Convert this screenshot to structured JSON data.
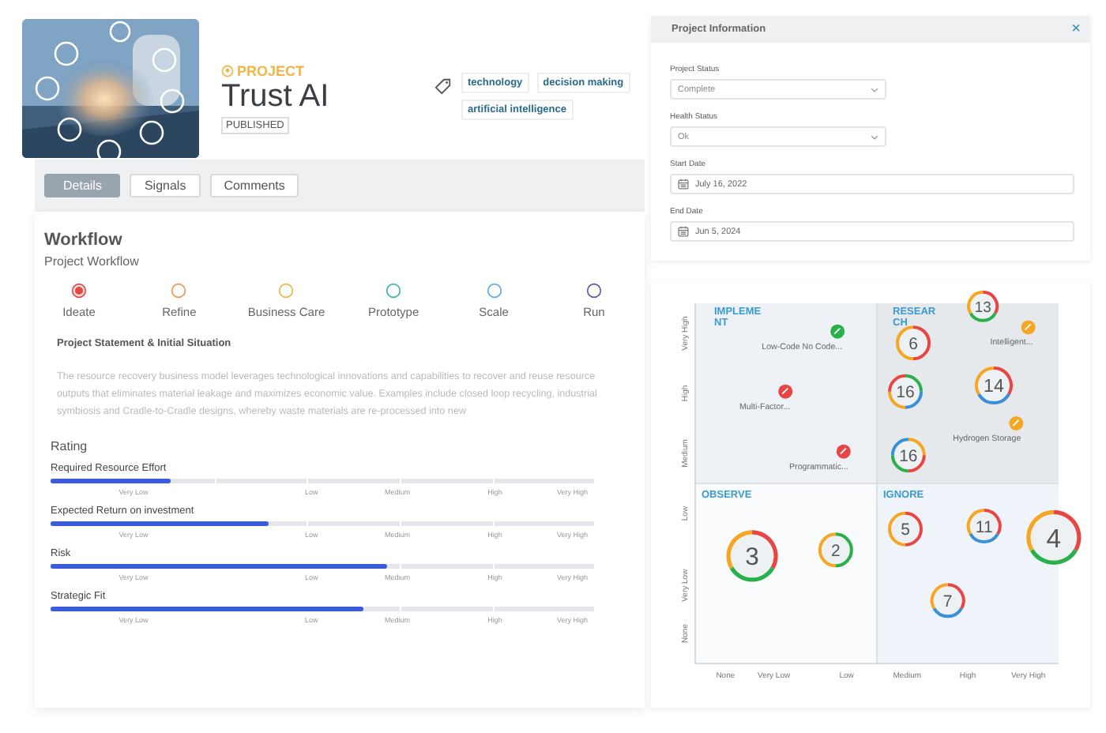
{
  "header": {
    "kind": "picture",
    "eyebrow": "PROJECT",
    "title": "Trust AI",
    "status": "PUBLISHED",
    "tags": [
      "technology",
      "decision making",
      "artificial intelligence"
    ]
  },
  "tabs": [
    {
      "label": "Details",
      "selected": true
    },
    {
      "label": "Signals",
      "selected": false
    },
    {
      "label": "Comments",
      "selected": false
    }
  ],
  "workflow": {
    "heading": "Workflow",
    "subheading": "Project Workflow",
    "steps": [
      {
        "label": "Ideate",
        "color": "#e84545",
        "selected": true
      },
      {
        "label": "Refine",
        "color": "#f0964a",
        "selected": false
      },
      {
        "label": "Business Care",
        "color": "#f2b544",
        "selected": false
      },
      {
        "label": "Prototype",
        "color": "#3bb3bd",
        "selected": false
      },
      {
        "label": "Scale",
        "color": "#5aaee0",
        "selected": false
      },
      {
        "label": "Run",
        "color": "#5a5aa8",
        "selected": false
      }
    ]
  },
  "statement": {
    "title": "Project Statement & Initial Situation",
    "text": "The resource recovery business model leverages technological innovations and capabilities to recover and reuse resource outputs that eliminates material leakage and maximizes economic value. Examples include closed loop recycling, industrial symbiosis and Cradle-to-Cradle designs, whereby waste materials are re-processed into new"
  },
  "rating": {
    "heading": "Rating",
    "rows": [
      {
        "name": "Required Resource Effort",
        "level": 0.22,
        "scale": [
          "Very Low",
          "Low",
          "Medium",
          "High",
          "Very High"
        ]
      },
      {
        "name": "Expected Return on investment",
        "level": 0.4,
        "scale": [
          "Very Low",
          "Low",
          "Medium",
          "High",
          "Very High"
        ]
      },
      {
        "name": "Risk",
        "level": 0.62,
        "scale": [
          "Very Low",
          "Low",
          "Medium",
          "High",
          "Very High"
        ]
      },
      {
        "name": "Strategic Fit",
        "level": 0.575,
        "scale": [
          "Very Low",
          "Low",
          "Medium",
          "High",
          "Very High"
        ]
      }
    ]
  },
  "info_panel": {
    "title": "Project Information",
    "close": "×",
    "fields": [
      {
        "kind": "select",
        "label": "Project Status",
        "value": "Complete"
      },
      {
        "kind": "select",
        "label": "Health Status",
        "value": "Ok"
      },
      {
        "kind": "date",
        "label": "Start Date",
        "value": "July 16, 2022"
      },
      {
        "kind": "date",
        "label": "End Date",
        "value": "Jun 5, 2024"
      }
    ]
  },
  "matrix": {
    "x_axis": [
      "None",
      "Very Low",
      "Low",
      "Medium",
      "High",
      "Very High"
    ],
    "y_axis": [
      "None",
      "Very Low",
      "Low",
      "Medium",
      "High",
      "Very High"
    ],
    "quadrants": [
      "IMPLEMENT",
      "RESEARCH",
      "OBSERVE",
      "IGNORE"
    ],
    "markers": [
      {
        "kind": "project",
        "label": "Low-Code No Code...",
        "color": "#2ab04a"
      },
      {
        "kind": "project",
        "label": "Intelligent...",
        "color": "#f5a623"
      },
      {
        "kind": "project",
        "label": "Multi-Factor...",
        "color": "#e84545"
      },
      {
        "kind": "project",
        "label": "Hydrogen Storage",
        "color": "#f5a623"
      },
      {
        "kind": "project",
        "label": "Programmatic...",
        "color": "#e84545"
      },
      {
        "kind": "cluster",
        "label": "13"
      },
      {
        "kind": "cluster",
        "label": "6"
      },
      {
        "kind": "cluster",
        "label": "16"
      },
      {
        "kind": "cluster",
        "label": "14"
      },
      {
        "kind": "cluster",
        "label": "16"
      },
      {
        "kind": "cluster",
        "label": "3"
      },
      {
        "kind": "cluster",
        "label": "2"
      },
      {
        "kind": "cluster",
        "label": "5"
      },
      {
        "kind": "cluster",
        "label": "11"
      },
      {
        "kind": "cluster",
        "label": "4"
      },
      {
        "kind": "cluster",
        "label": "7"
      }
    ]
  }
}
